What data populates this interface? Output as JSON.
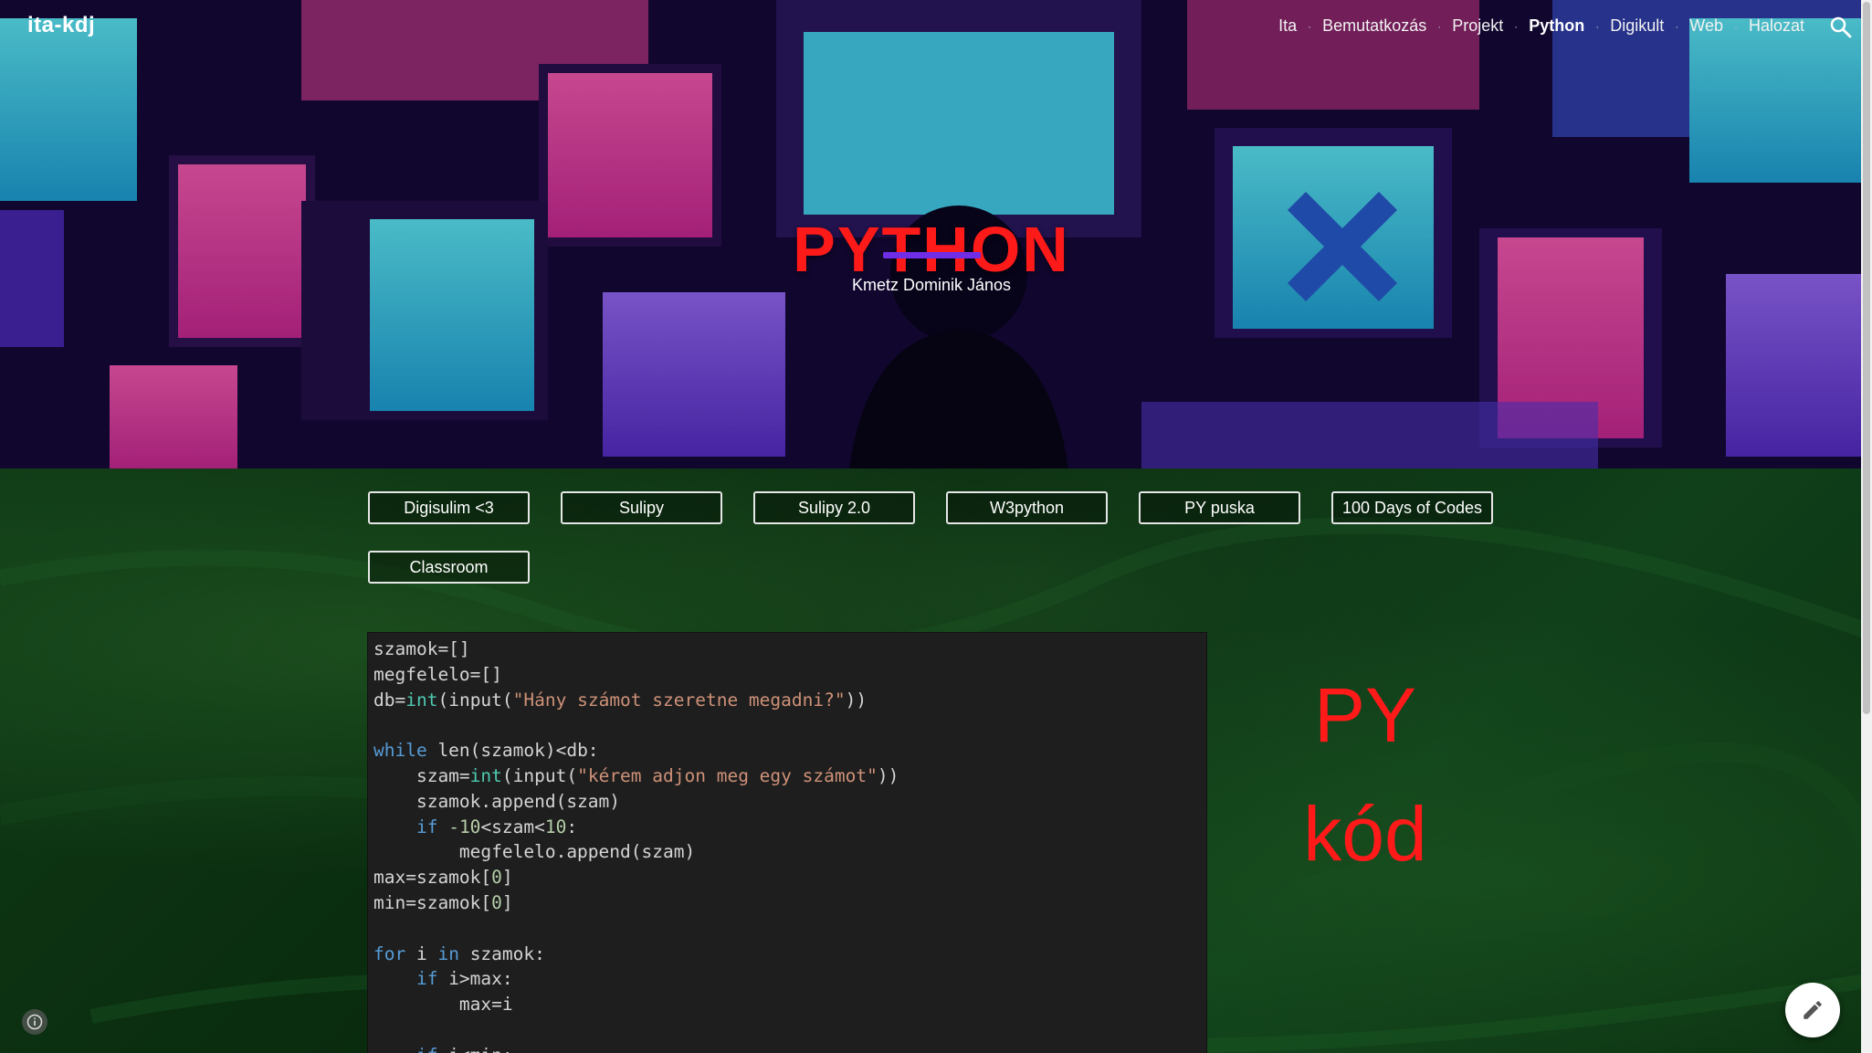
{
  "site": {
    "title": "ita-kdj"
  },
  "nav": {
    "items": [
      {
        "label": "Ita"
      },
      {
        "label": "Bemutatkozás"
      },
      {
        "label": "Projekt"
      },
      {
        "label": "Python",
        "active": true
      },
      {
        "label": "Digikult"
      },
      {
        "label": "Web"
      },
      {
        "label": "Halozat"
      }
    ],
    "separator": "·",
    "search_icon": "search-icon"
  },
  "hero": {
    "title": "PYTHON",
    "subtitle": "Kmetz Dominik János",
    "accent_color": "#ff1a1a",
    "underline_color": "#6f2ee6"
  },
  "buttons": [
    {
      "label": "Digisulim <3"
    },
    {
      "label": "Sulipy"
    },
    {
      "label": "Sulipy 2.0"
    },
    {
      "label": "W3python"
    },
    {
      "label": "PY puska"
    },
    {
      "label": "100 Days of Codes"
    },
    {
      "label": "Classroom"
    }
  ],
  "code": {
    "lines": [
      "szamok=[]",
      "megfelelo=[]",
      "db=int(input(\"Hány számot szeretne megadni?\"))",
      "",
      "while len(szamok)<db:",
      "    szam=int(input(\"kérem adjon meg egy számot\"))",
      "    szamok.append(szam)",
      "    if -10<szam<10:",
      "        megfelelo.append(szam)",
      "max=szamok[0]",
      "min=szamok[0]",
      "",
      "for i in szamok:",
      "    if i>max:",
      "        max=i",
      "",
      "    if i<min:"
    ]
  },
  "side_label": {
    "line1": "PY",
    "line2": "kód"
  },
  "floating": {
    "info_icon": "info-icon",
    "edit_icon": "pencil-icon"
  }
}
